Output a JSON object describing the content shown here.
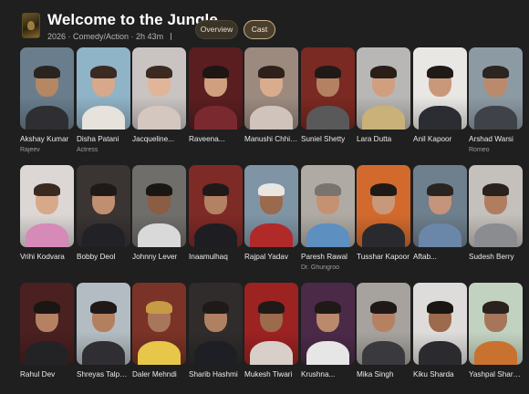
{
  "header": {
    "logo_icon": "movie-poster-icon",
    "title": "Welcome to the Jungle",
    "meta": "2026 · Comedy/Action · 2h 43m"
  },
  "tabs": [
    {
      "label": "Overview",
      "active": false
    },
    {
      "label": "Cast",
      "active": true
    }
  ],
  "cast": [
    {
      "name": "Akshay Kumar",
      "role": "Rajeev",
      "bg": "#6a7d8c",
      "skin": "#b58763",
      "hair": "#2a2420",
      "cloth": "#2e2e33"
    },
    {
      "name": "Disha Patani",
      "role": "Actress",
      "bg": "#8fb3c7",
      "skin": "#d7a98a",
      "hair": "#3b2a22",
      "cloth": "#e8e2dc"
    },
    {
      "name": "Jacqueline...",
      "role": "",
      "bg": "#c9c4c2",
      "skin": "#e0b59a",
      "hair": "#3a2a22",
      "cloth": "#d4c7bf"
    },
    {
      "name": "Raveena...",
      "role": "",
      "bg": "#5a1e20",
      "skin": "#cf9f80",
      "hair": "#1e1614",
      "cloth": "#7a2a2e"
    },
    {
      "name": "Manushi Chhillar",
      "role": "",
      "bg": "#9c8a7f",
      "skin": "#d9ac8d",
      "hair": "#2e201a",
      "cloth": "#cfc3bc"
    },
    {
      "name": "Suniel Shetty",
      "role": "",
      "bg": "#7a2a22",
      "skin": "#b48263",
      "hair": "#1f1a18",
      "cloth": "#595959"
    },
    {
      "name": "Lara Dutta",
      "role": "",
      "bg": "#b9b7b5",
      "skin": "#cf9f80",
      "hair": "#2a1e19",
      "cloth": "#c9b179"
    },
    {
      "name": "Anil Kapoor",
      "role": "",
      "bg": "#e9e7e4",
      "skin": "#c9987a",
      "hair": "#1f1a18",
      "cloth": "#2b2d33"
    },
    {
      "name": "Arshad Warsi",
      "role": "Romeo",
      "bg": "#8c9aa3",
      "skin": "#b98a6c",
      "hair": "#2c2420",
      "cloth": "#3f4248"
    },
    {
      "name": "Vrihi Kodvara",
      "role": "",
      "bg": "#dcd7d5",
      "skin": "#d7a98a",
      "hair": "#3a2a20",
      "cloth": "#d68ab7"
    },
    {
      "name": "Bobby Deol",
      "role": "",
      "bg": "#3a3433",
      "skin": "#c08f70",
      "hair": "#1f1a18",
      "cloth": "#222226"
    },
    {
      "name": "Johnny Lever",
      "role": "",
      "bg": "#6f6e6b",
      "skin": "#8a5d44",
      "hair": "#1a1614",
      "cloth": "#d9d9d9"
    },
    {
      "name": "Inaamulhaq",
      "role": "",
      "bg": "#7e2a26",
      "skin": "#b48263",
      "hair": "#1f1a18",
      "cloth": "#1e1e22"
    },
    {
      "name": "Rajpal Yadav",
      "role": "",
      "bg": "#7f95a6",
      "skin": "#9a6a4c",
      "hair": "#e9e6e1",
      "cloth": "#b02a2a"
    },
    {
      "name": "Paresh Rawal",
      "role": "Dr. Ghungroo",
      "bg": "#b0aaa4",
      "skin": "#c49273",
      "hair": "#7a7470",
      "cloth": "#5d8fc1"
    },
    {
      "name": "Tusshar Kapoor",
      "role": "",
      "bg": "#d26a2e",
      "skin": "#c8987a",
      "hair": "#1f1a18",
      "cloth": "#2a2a2e"
    },
    {
      "name": "Aftab...",
      "role": "",
      "bg": "#6e7f8d",
      "skin": "#c4957a",
      "hair": "#2a2420",
      "cloth": "#6a86a8"
    },
    {
      "name": "Sudesh Berry",
      "role": "",
      "bg": "#c4c0bc",
      "skin": "#b07e5f",
      "hair": "#2a221e",
      "cloth": "#8a8c90"
    },
    {
      "name": "Rahul Dev",
      "role": "",
      "bg": "#4a2020",
      "skin": "#b48263",
      "hair": "#1a1614",
      "cloth": "#232326"
    },
    {
      "name": "Shreyas Talpade",
      "role": "",
      "bg": "#b3bcc2",
      "skin": "#b3805f",
      "hair": "#1f1a18",
      "cloth": "#2f2f33"
    },
    {
      "name": "Daler Mehndi",
      "role": "",
      "bg": "#7a3326",
      "skin": "#a8765a",
      "hair": "#c79a45",
      "cloth": "#e6c74a"
    },
    {
      "name": "Sharib Hashmi",
      "role": "",
      "bg": "#2f2c2b",
      "skin": "#b08063",
      "hair": "#1f1a18",
      "cloth": "#1d1f24"
    },
    {
      "name": "Mukesh Tiwari",
      "role": "",
      "bg": "#9d2222",
      "skin": "#9c6a4c",
      "hair": "#1f1a18",
      "cloth": "#d8cfc8"
    },
    {
      "name": "Krushna...",
      "role": "",
      "bg": "#4b2a48",
      "skin": "#b98a6c",
      "hair": "#1f1a18",
      "cloth": "#e6e6e6"
    },
    {
      "name": "Mika Singh",
      "role": "",
      "bg": "#a6a29e",
      "skin": "#b48263",
      "hair": "#1f1a18",
      "cloth": "#3a3a3e"
    },
    {
      "name": "Kiku Sharda",
      "role": "",
      "bg": "#dedcda",
      "skin": "#9c6a4c",
      "hair": "#1a1614",
      "cloth": "#2b2b2f"
    },
    {
      "name": "Yashpal Sharma",
      "role": "",
      "bg": "#c2d2c0",
      "skin": "#a6765a",
      "hair": "#2a221e",
      "cloth": "#c9712e"
    }
  ]
}
